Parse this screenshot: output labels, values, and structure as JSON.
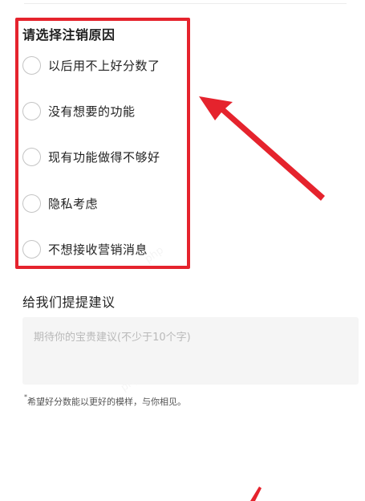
{
  "reasons": {
    "title": "请选择注销原因",
    "options": [
      {
        "label": "以后用不上好分数了",
        "selected": false
      },
      {
        "label": "没有想要的功能",
        "selected": false
      },
      {
        "label": "现有功能做得不够好",
        "selected": false
      },
      {
        "label": "隐私考虑",
        "selected": false
      },
      {
        "label": "不想接收营销消息",
        "selected": false
      }
    ]
  },
  "suggestion": {
    "title": "给我们提提建议",
    "placeholder": "期待你的宝贵建议(不少于10个字)",
    "value": ""
  },
  "footnote": {
    "mark": "*",
    "text": "希望好分数能以更好的模样，与你相见。"
  },
  "colors": {
    "highlight": "#e5232d",
    "radio_border": "#c4c4c4",
    "input_bg": "#f5f5f5"
  },
  "icons": {
    "annotation_arrow": "arrow-icon",
    "radio": "radio-circle-icon"
  }
}
